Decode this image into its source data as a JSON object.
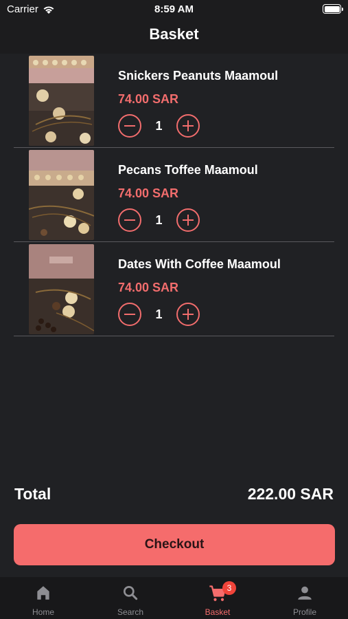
{
  "status_bar": {
    "carrier": "Carrier",
    "time": "8:59 AM"
  },
  "header": {
    "title": "Basket"
  },
  "items": [
    {
      "name": "Snickers Peanuts Maamoul",
      "price": "74.00 SAR",
      "quantity": "1"
    },
    {
      "name": "Pecans Toffee Maamoul",
      "price": "74.00 SAR",
      "quantity": "1"
    },
    {
      "name": "Dates With Coffee Maamoul",
      "price": "74.00 SAR",
      "quantity": "1"
    }
  ],
  "summary": {
    "total_label": "Total",
    "total_value": "222.00 SAR"
  },
  "checkout": {
    "label": "Checkout"
  },
  "tabs": [
    {
      "label": "Home",
      "icon": "home-icon"
    },
    {
      "label": "Search",
      "icon": "search-icon"
    },
    {
      "label": "Basket",
      "icon": "cart-icon",
      "badge": "3",
      "active": true
    },
    {
      "label": "Profile",
      "icon": "person-icon"
    }
  ],
  "colors": {
    "accent": "#f56c6c",
    "background": "#202124",
    "bar_background": "#1c1c1e",
    "badge": "#f0443a"
  }
}
